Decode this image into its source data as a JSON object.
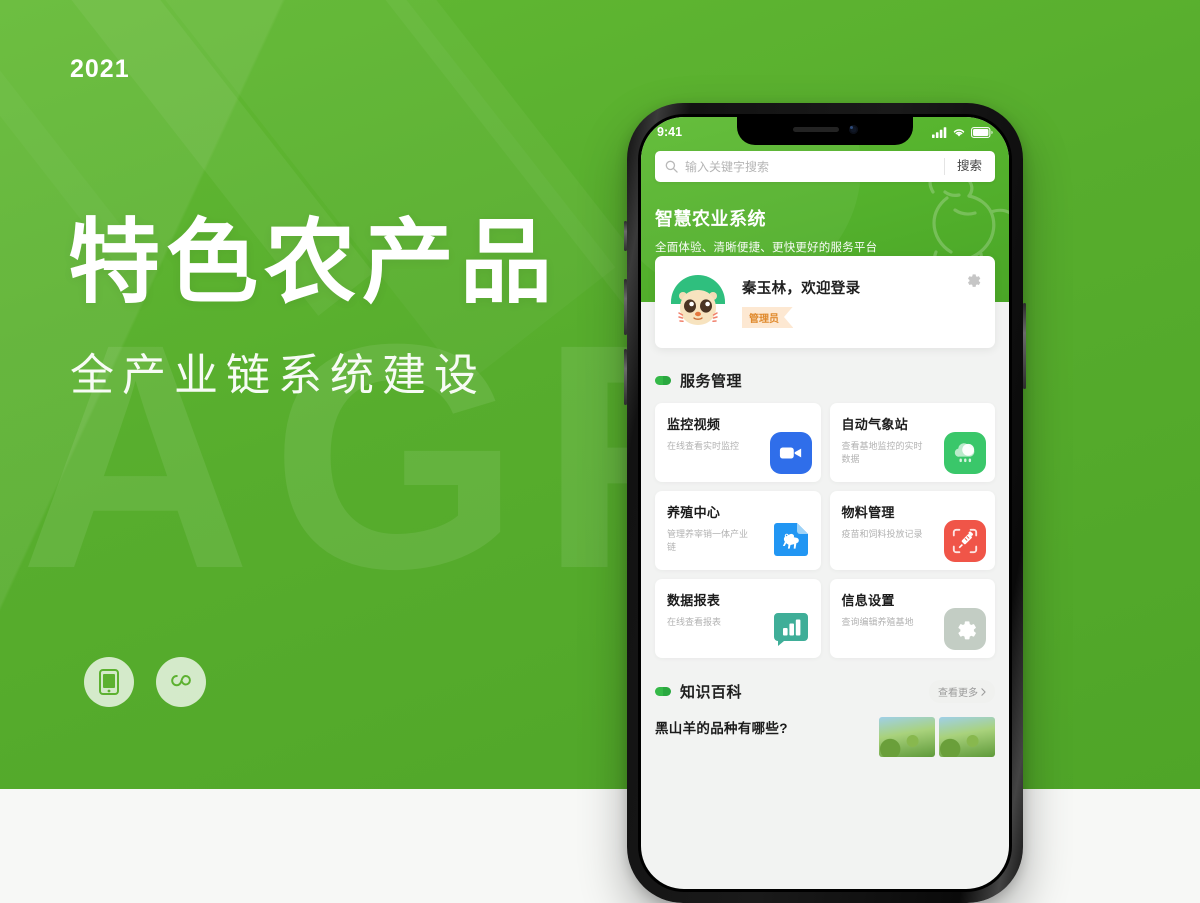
{
  "hero": {
    "year": "2021",
    "headline": "特色农产品",
    "subhead": "全产业链系统建设",
    "watermark": "AGRU",
    "accent_green": "#5cb130",
    "badges": [
      {
        "name": "mobile-app-badge",
        "icon": "mobile-phone-icon"
      },
      {
        "name": "mini-program-badge",
        "icon": "wechat-miniprogram-icon"
      }
    ]
  },
  "phone": {
    "statusbar": {
      "time": "9:41",
      "signal_icon": "cellular-signal-icon",
      "wifi_icon": "wifi-icon",
      "battery_icon": "battery-full-icon"
    },
    "search": {
      "placeholder": "输入关键字搜索",
      "value": "",
      "button_label": "搜索",
      "icon": "search-icon"
    },
    "header": {
      "title": "智慧农业系统",
      "subtitle": "全面体验、清晰便捷、更快更好的服务平台",
      "watermark_icon": "goat-silhouette-icon"
    },
    "profile": {
      "greeting": "秦玉林，欢迎登录",
      "role": "管理员",
      "settings_icon": "gear-icon",
      "avatar_icon": "cartoon-avatar-icon"
    },
    "services_section": {
      "title": "服务管理",
      "items": [
        {
          "title": "监控视频",
          "desc": "在线查看实时监控",
          "icon": "video-camera-icon",
          "color": "#2f6eea"
        },
        {
          "title": "自动气象站",
          "desc": "查看基地监控的实时数据",
          "icon": "cloud-rain-icon",
          "color": "#3ac76a"
        },
        {
          "title": "养殖中心",
          "desc": "管理养宰销一体产业链",
          "icon": "goat-document-icon",
          "color": "#2196f3"
        },
        {
          "title": "物料管理",
          "desc": "疫苗和饲料投放记录",
          "icon": "syringe-scan-icon",
          "color": "#f05548"
        },
        {
          "title": "数据报表",
          "desc": "在线查看报表",
          "icon": "bar-chart-icon",
          "color": "#3fae98"
        },
        {
          "title": "信息设置",
          "desc": "查询编辑养殖基地",
          "icon": "gear-icon",
          "color": "#c3cdc4"
        }
      ]
    },
    "knowledge_section": {
      "title": "知识百科",
      "more_label": "查看更多",
      "more_chevron": "chevron-right-icon",
      "articles": [
        {
          "title": "黑山羊的品种有哪些?"
        }
      ]
    }
  }
}
